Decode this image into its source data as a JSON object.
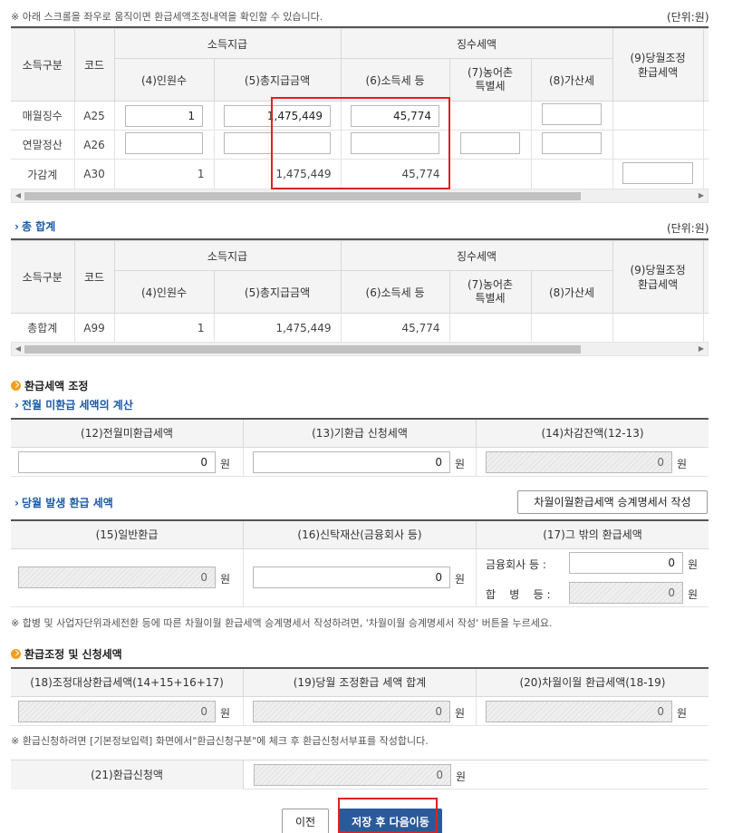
{
  "top_note": "※ 아래 스크롤을 좌우로 움직이면 환급세액조정내역을 확인할 수 있습니다.",
  "unit_label": "(단위:원)",
  "table_headers": {
    "income_type": "소득구분",
    "code": "코드",
    "income_payment": "소득지급",
    "tax_withheld": "징수세액",
    "refund_adjust": "(9)당월조정\n환급세액",
    "col4": "(4)인원수",
    "col5": "(5)총지급금액",
    "col6": "(6)소득세 등",
    "col7": "(7)농어촌\n특별세",
    "col8": "(8)가산세"
  },
  "table1_rows": [
    {
      "type": "매월징수",
      "code": "A25",
      "persons": "1",
      "total": "1,475,449",
      "tax": "45,774"
    },
    {
      "type": "연말정산",
      "code": "A26",
      "persons": "",
      "total": "",
      "tax": ""
    },
    {
      "type": "가감계",
      "code": "A30",
      "persons": "1",
      "total": "1,475,449",
      "tax": "45,774"
    }
  ],
  "grand_total_title": "총 합계",
  "table2_row": {
    "type": "총합계",
    "code": "A99",
    "persons": "1",
    "total": "1,475,449",
    "tax": "45,774"
  },
  "refund_adjust_title": "환급세액 조정",
  "prev_month_title": "전월 미환급 세액의 계산",
  "prev_month_headers": [
    "(12)전월미환급세액",
    "(13)기환급 신청세액",
    "(14)차감잔액(12-13)"
  ],
  "prev_month_values": [
    "0",
    "0",
    "0"
  ],
  "won": "원",
  "current_month_title": "당월 발생 환급 세액",
  "carryover_button": "차월이월환급세액 승계명세서 작성",
  "current_month_headers": [
    "(15)일반환급",
    "(16)신탁재산(금융회사 등)",
    "(17)그 밖의 환급세액"
  ],
  "current_month_values": [
    "0",
    "0"
  ],
  "financial_label": "금융회사 등 :",
  "financial_value": "0",
  "merger_label": "합    병    등 :",
  "merger_value": "0",
  "merger_note": "※ 합병 및 사업자단위과세전환 등에 따른 차월이월 환급세액 승계명세서 작성하려면, '차월이월 승계명세서 작성' 버튼을 누르세요.",
  "refund_request_title": "환급조정 및 신청세액",
  "refund_request_headers": [
    "(18)조정대상환급세액(14+15+16+17)",
    "(19)당월 조정환급 세액 합계",
    "(20)차월이월 환급세액(18-19)"
  ],
  "refund_request_values": [
    "0",
    "0",
    "0"
  ],
  "refund_apply_note": "※ 환급신청하려면 [기본정보입력] 화면에서\"환급신청구분\"에 체크 후 환급신청서부표를 작성합니다.",
  "refund_apply_label": "(21)환급신청액",
  "refund_apply_value": "0",
  "prev_button": "이전",
  "save_next_button": "저장 후 다음이동"
}
